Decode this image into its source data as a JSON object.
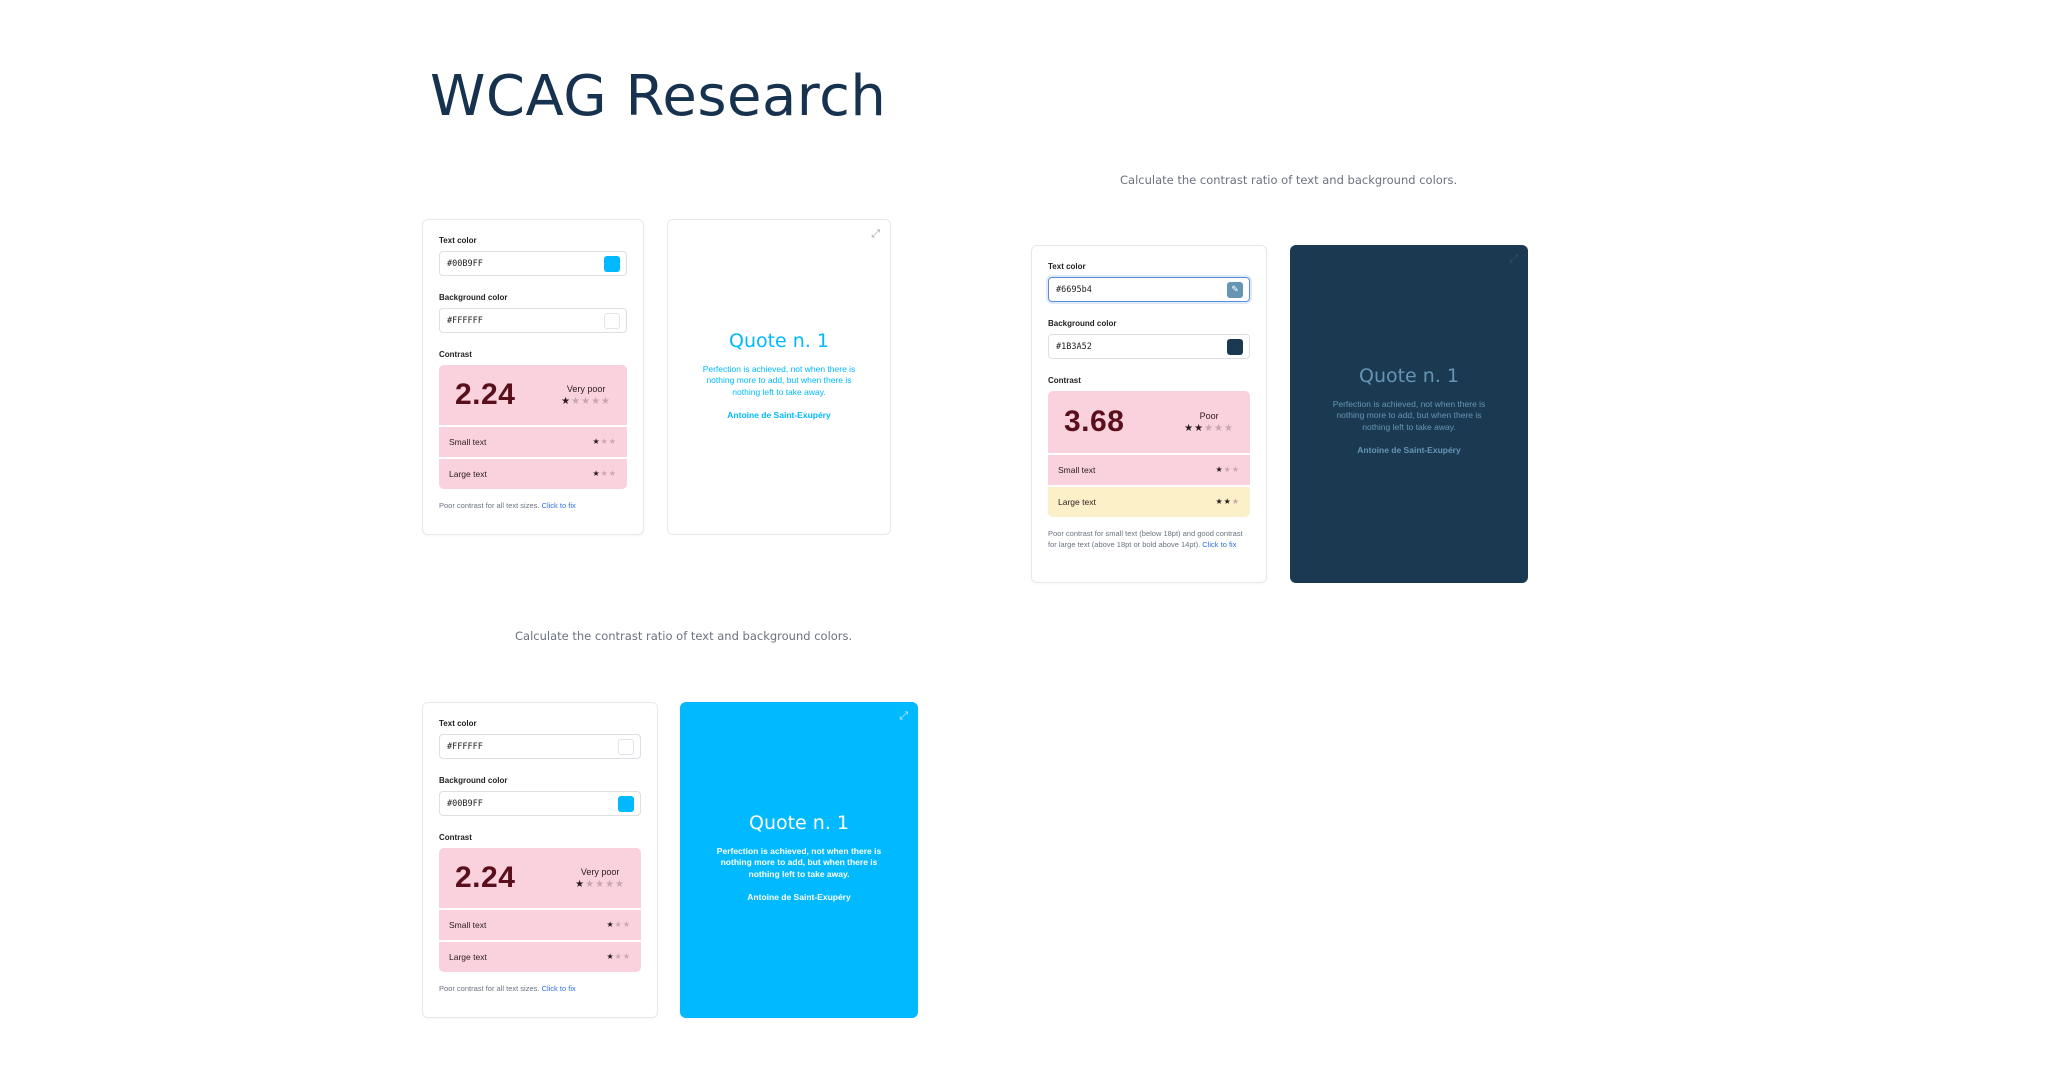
{
  "page": {
    "title": "WCAG Research"
  },
  "captions": {
    "top_right": "Calculate the contrast ratio of text and background colors.",
    "middle_left": "Calculate the contrast ratio of text and background colors."
  },
  "panel1": {
    "text_color_label": "Text color",
    "text_color_value": "#00B9FF",
    "bg_color_label": "Background color",
    "bg_color_value": "#FFFFFF",
    "contrast_label": "Contrast",
    "ratio": "2.24",
    "rating": "Very poor",
    "rating_stars": 1,
    "small_text_label": "Small text",
    "small_text_stars": 1,
    "large_text_label": "Large text",
    "large_text_stars": 1,
    "note": "Poor contrast for all text sizes.",
    "fix_link": "Click to fix"
  },
  "panel2": {
    "text_color_label": "Text color",
    "text_color_value": "#6695b4",
    "bg_color_label": "Background color",
    "bg_color_value": "#1B3A52",
    "contrast_label": "Contrast",
    "ratio": "3.68",
    "rating": "Poor",
    "rating_stars": 2,
    "small_text_label": "Small text",
    "small_text_stars": 1,
    "large_text_label": "Large text",
    "large_text_stars": 2,
    "note": "Poor contrast for small text (below 18pt) and good contrast for large text (above 18pt or bold above 14pt).",
    "fix_link": "Click to fix"
  },
  "panel3": {
    "text_color_label": "Text color",
    "text_color_value": "#FFFFFF",
    "bg_color_label": "Background color",
    "bg_color_value": "#00B9FF",
    "contrast_label": "Contrast",
    "ratio": "2.24",
    "rating": "Very poor",
    "rating_stars": 1,
    "small_text_label": "Small text",
    "small_text_stars": 1,
    "large_text_label": "Large text",
    "large_text_stars": 1,
    "note": "Poor contrast for all text sizes.",
    "fix_link": "Click to fix"
  },
  "quote": {
    "title": "Quote n. 1",
    "text": "Perfection is achieved, not when there is nothing more to add, but when there is nothing left to take away.",
    "author": "Antoine de Saint-Exupéry"
  },
  "colors": {
    "light_blue": "#00B9FF",
    "white": "#FFFFFF",
    "navy": "#1B3A52",
    "muted_blue": "#6695b4",
    "pink": "#fad2de",
    "yellow": "#fbf0c8",
    "link": "#2f6fe0"
  },
  "icons": [
    "expand-icon",
    "eyedropper-icon",
    "star-icon"
  ]
}
